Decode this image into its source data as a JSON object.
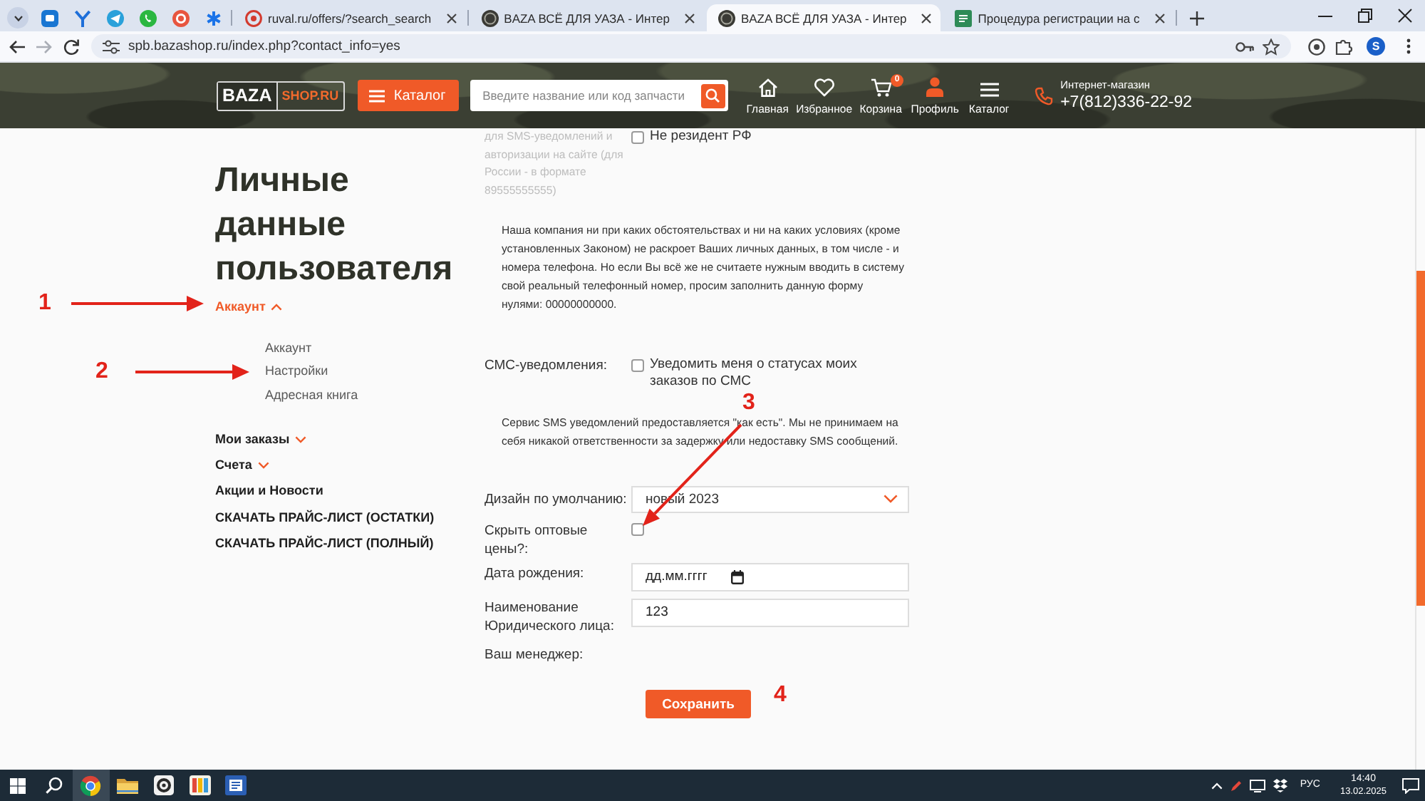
{
  "browser": {
    "pinned_tabs": [
      {
        "selected": false
      },
      {
        "selected": false
      },
      {
        "selected": false
      },
      {
        "selected": false
      },
      {
        "selected": false
      },
      {
        "selected": false
      }
    ],
    "tabs": [
      {
        "title": "ruval.ru/offers/?search_search",
        "selected": false
      },
      {
        "title": "BAZA ВСЁ ДЛЯ УАЗА - Интер",
        "selected": false
      },
      {
        "title": "BAZA ВСЁ ДЛЯ УАЗА - Интер",
        "selected": true
      },
      {
        "title": "Процедура регистрации на с",
        "selected": false
      }
    ],
    "address": "spb.bazashop.ru/index.php?contact_info=yes",
    "profile_initial": "S"
  },
  "header": {
    "logo": {
      "brand": "BAZA",
      "domain": "SHOP.RU"
    },
    "catalog_button": "Каталог",
    "search": {
      "placeholder": "Введите название или код запчасти"
    },
    "nav": [
      {
        "label": "Главная",
        "selected": false
      },
      {
        "label": "Избранное",
        "selected": false
      },
      {
        "label": "Корзина",
        "badge": "0",
        "selected": false
      },
      {
        "label": "Профиль",
        "selected": true
      },
      {
        "label": "Каталог",
        "selected": false
      }
    ],
    "contact": {
      "caption": "Интернет-магазин",
      "phone": "+7(812)336-22-92"
    }
  },
  "sidebar": {
    "title": "Личные данные пользователя",
    "items": [
      {
        "kind": "group",
        "label": "Аккаунт",
        "expanded": true,
        "children": [
          {
            "label": "Аккаунт"
          },
          {
            "label": "Настройки"
          },
          {
            "label": "Адресная книга"
          }
        ]
      },
      {
        "kind": "group",
        "label": "Мои заказы",
        "expanded": false
      },
      {
        "kind": "group",
        "label": "Счета",
        "expanded": false
      },
      {
        "kind": "link",
        "label": "Акции и Новости"
      },
      {
        "kind": "link",
        "label": "СКАЧАТЬ ПРАЙС-ЛИСТ (ОСТАТКИ)"
      },
      {
        "kind": "link",
        "label": "СКАЧАТЬ ПРАЙС-ЛИСТ (ПОЛНЫЙ)"
      }
    ]
  },
  "form": {
    "phone_hint": "для SMS-уведомлений и авторизации на сайте (для России - в формате 89555555555)",
    "non_resident": {
      "label": "Не резидент РФ",
      "checked": false
    },
    "privacy_note": "Наша компания ни при каких обстоятельствах и ни на каких условиях (кроме установленных Законом) не раскроет Ваших личных данных, в том числе - и номера телефона. Но если Вы всё же не считаете нужным вводить в систему свой реальный телефонный номер, просим заполнить данную форму нулями: 00000000000.",
    "fields": [
      {
        "kind": "checkbox",
        "label": "СМС-уведомления:",
        "option": "Уведомить меня о статусах моих заказов по СМС",
        "checked": false
      },
      {
        "kind": "note",
        "text": "Сервис SMS уведомлений предоставляется \"как есть\". Мы не принимаем на себя никакой ответственности за задержку или недоставку SMS сообщений."
      },
      {
        "kind": "select",
        "label": "Дизайн по умолчанию:",
        "value": "новый 2023"
      },
      {
        "kind": "checkbox",
        "label": "Скрыть оптовые цены?:",
        "checked": false
      },
      {
        "kind": "date",
        "label": "Дата рождения:",
        "placeholder": "дд.мм.гггг"
      },
      {
        "kind": "text",
        "label": "Наименование Юридического лица:",
        "value": "123"
      },
      {
        "kind": "static",
        "label": "Ваш менеджер:"
      }
    ],
    "submit": "Сохранить"
  },
  "annotations": [
    {
      "label": "1",
      "arrow": true
    },
    {
      "label": "2",
      "arrow": true
    },
    {
      "label": "3",
      "arrow": true
    },
    {
      "label": "4",
      "arrow": false
    }
  ],
  "taskbar": {
    "apps": [
      {
        "selected": true
      },
      {
        "selected": false
      },
      {
        "selected": false
      },
      {
        "selected": false
      },
      {
        "selected": false
      }
    ],
    "language": "РУС",
    "time": "14:40",
    "date": "13.02.2025"
  }
}
